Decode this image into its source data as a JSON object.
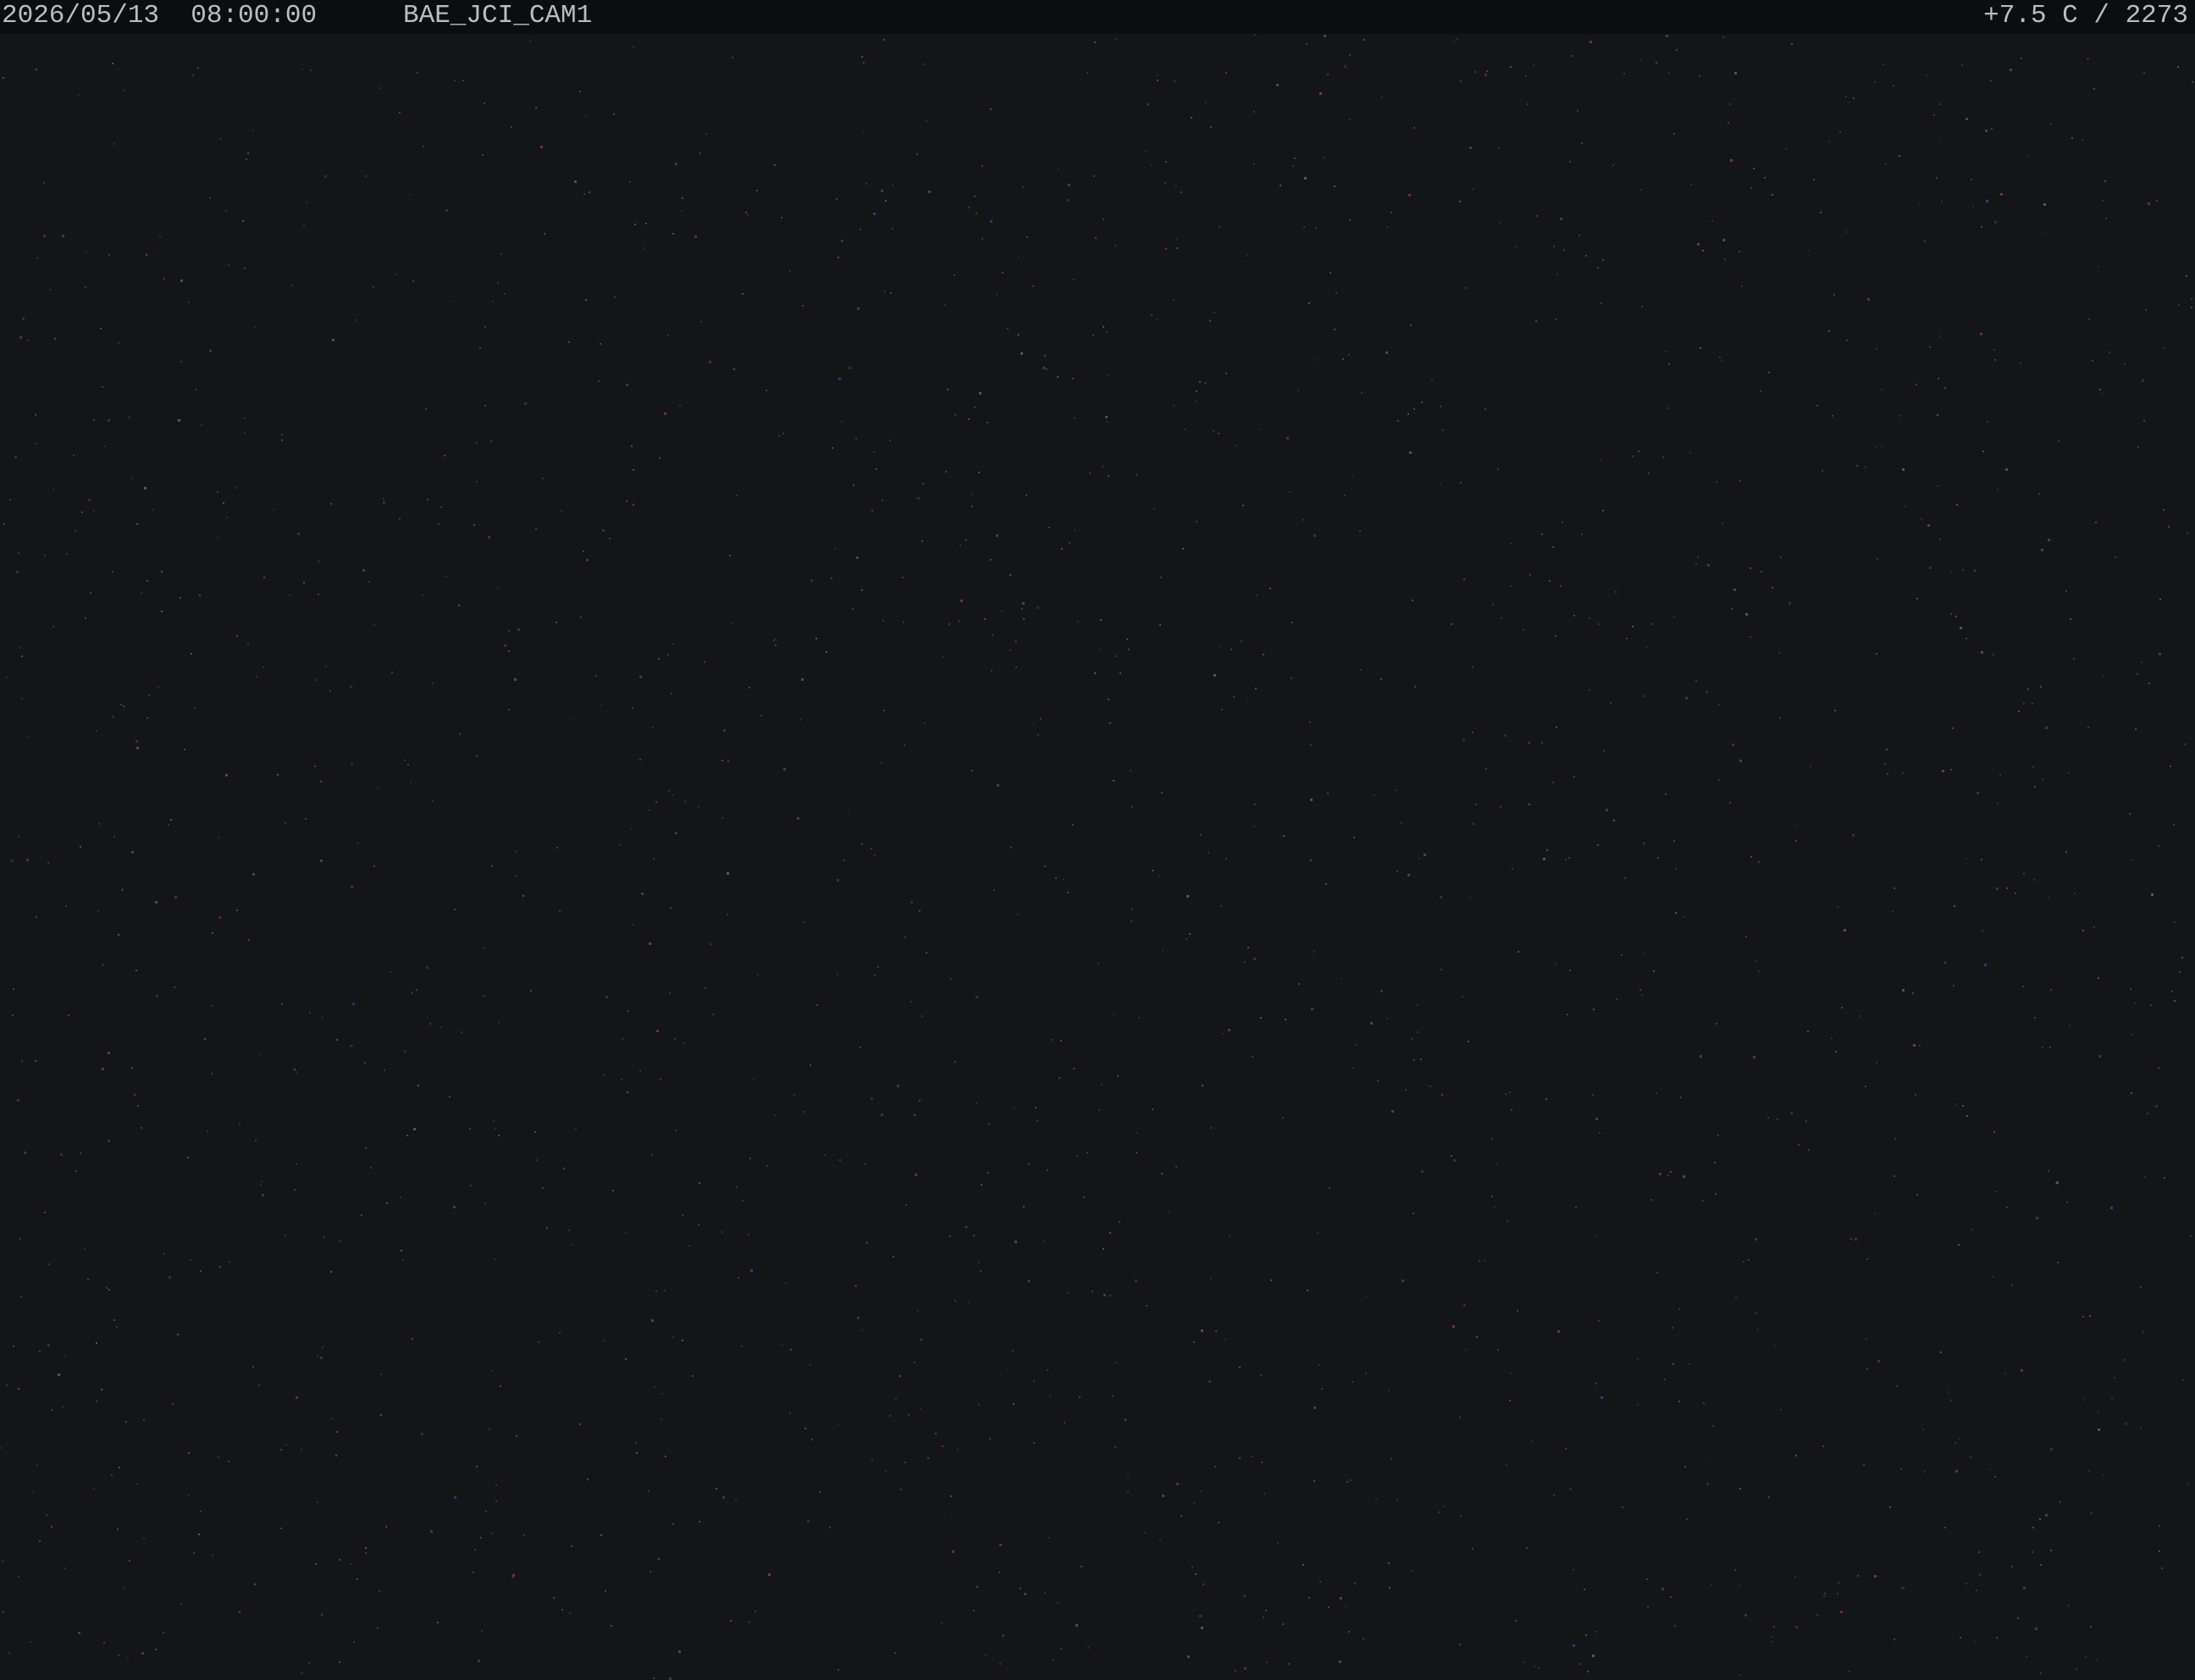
{
  "overlay": {
    "timestamp": "2026/05/13  08:00:00",
    "camera_id": "BAE_JCI_CAM1",
    "temperature_counter": "+7.5 C / 2273"
  },
  "image": {
    "description": "dark night sky camera frame",
    "background_color": "#141517",
    "noise_colors": [
      "#8a3a44",
      "#3a3f8a",
      "#3d6b4a",
      "#5a5a5a"
    ]
  }
}
